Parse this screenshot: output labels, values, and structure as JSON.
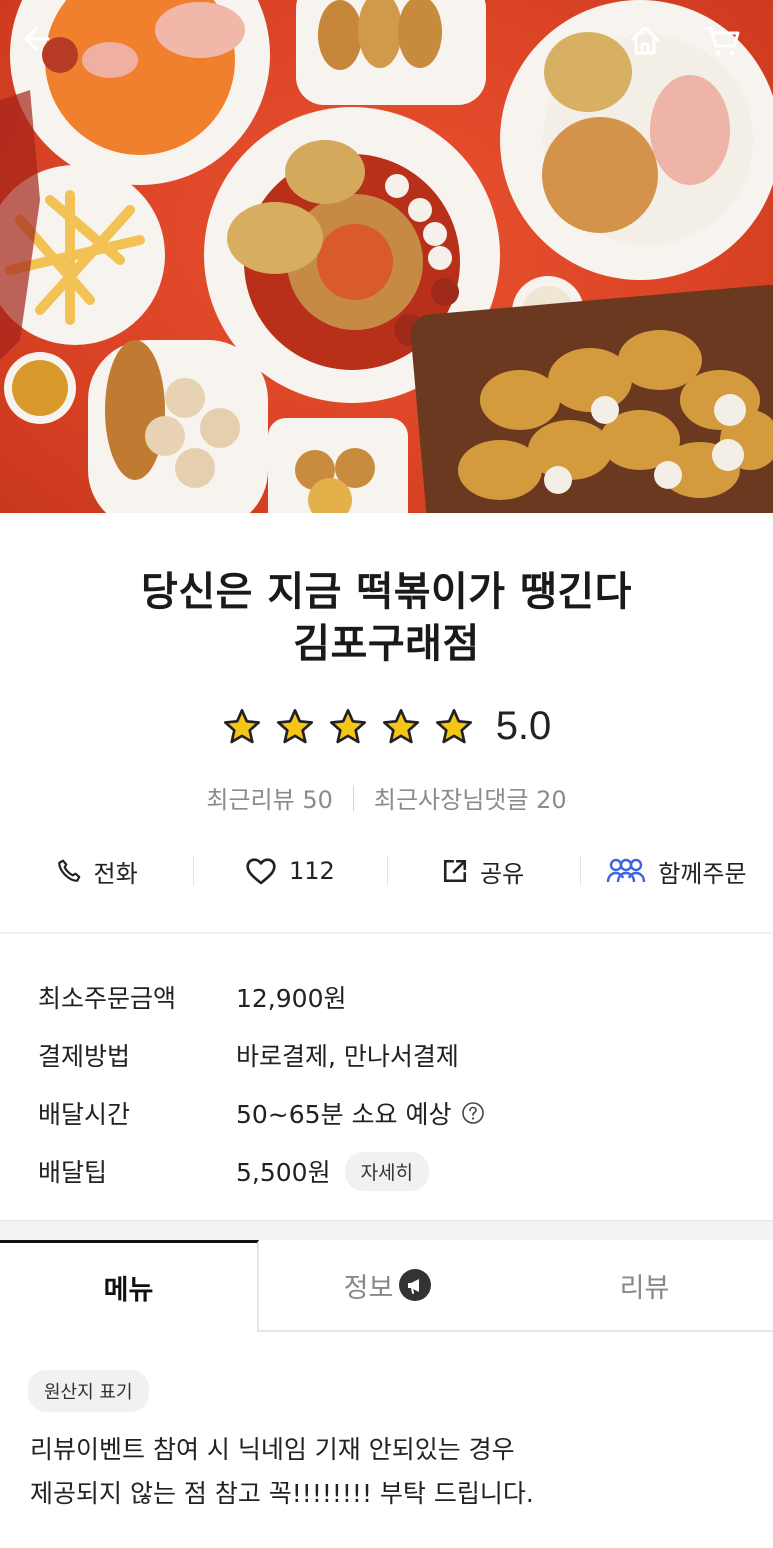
{
  "store": {
    "name_line1": "당신은 지금 떡볶이가 땡긴다",
    "name_line2": "김포구래점"
  },
  "rating": {
    "stars": 5,
    "score": "5.0"
  },
  "reviews": {
    "recent_reviews": "최근리뷰 50",
    "owner_replies": "최근사장님댓글 20"
  },
  "actions": {
    "call": "전화",
    "likes": "112",
    "share": "공유",
    "group_order": "함께주문"
  },
  "info": {
    "min_order_label": "최소주문금액",
    "min_order_value": "12,900원",
    "payment_label": "결제방법",
    "payment_value": "바로결제, 만나서결제",
    "delivery_time_label": "배달시간",
    "delivery_time_value": "50~65분 소요 예상",
    "delivery_tip_label": "배달팁",
    "delivery_tip_value": "5,500원",
    "detail_label": "자세히"
  },
  "tabs": {
    "menu": "메뉴",
    "info": "정보",
    "review": "리뷰"
  },
  "origin_chip": "원산지 표기",
  "notice": "리뷰이벤트 참여 시 닉네임 기재 안되있는 경우\n제공되지 않는 점 참고 꼭!!!!!!!! 부탁 드립니다.",
  "icons": {
    "back": "arrow-left-icon",
    "home": "home-icon",
    "cart": "cart-icon",
    "star": "star-icon",
    "phone": "phone-icon",
    "heart": "heart-icon",
    "share": "share-icon",
    "group": "group-icon",
    "help": "help-icon",
    "megaphone": "megaphone-icon"
  },
  "colors": {
    "hero_bg": "#dc4426",
    "star": "#f5c518",
    "group_icon": "#3d63e0"
  }
}
